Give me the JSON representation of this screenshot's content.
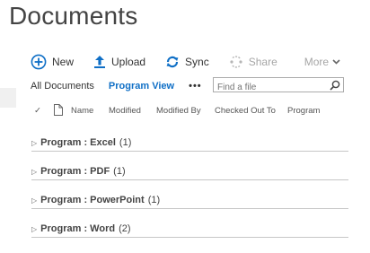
{
  "page": {
    "title": "Documents"
  },
  "toolbar": {
    "new_label": "New",
    "upload_label": "Upload",
    "sync_label": "Sync",
    "share_label": "Share",
    "more_label": "More"
  },
  "views": {
    "all_documents": "All Documents",
    "program_view": "Program View",
    "more_dots": "•••"
  },
  "search": {
    "placeholder": "Find a file"
  },
  "columns": {
    "check": "✓",
    "name": "Name",
    "modified": "Modified",
    "modified_by": "Modified By",
    "checked_out_to": "Checked Out To",
    "program": "Program"
  },
  "groups": [
    {
      "label": "Program : Excel",
      "count": "(1)"
    },
    {
      "label": "Program : PDF",
      "count": "(1)"
    },
    {
      "label": "Program : PowerPoint",
      "count": "(1)"
    },
    {
      "label": "Program : Word",
      "count": "(2)"
    }
  ],
  "colors": {
    "accent": "#0f6fc6",
    "disabled": "#a6a6a6"
  }
}
